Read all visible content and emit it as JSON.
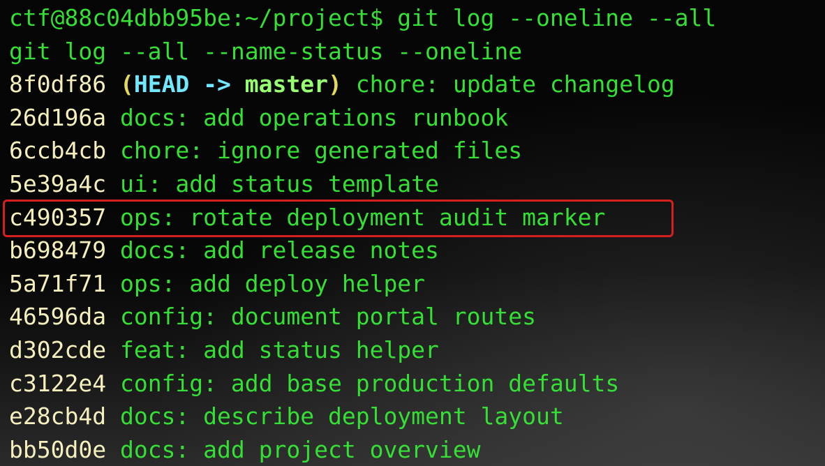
{
  "terminal": {
    "prompt_line": "ctf@88c04dbb95be:~/project$ git log --oneline --all",
    "typed_command": "git log --all --name-status --oneline",
    "head_ref": {
      "hash": "8f0df86",
      "open_paren": "(",
      "head": "HEAD",
      "arrow": " -> ",
      "branch": "master",
      "close_paren": ")",
      "message": "chore: update changelog"
    },
    "commits": [
      {
        "hash": "26d196a",
        "message": "docs: add operations runbook"
      },
      {
        "hash": "6ccb4cb",
        "message": "chore: ignore generated files"
      },
      {
        "hash": "5e39a4c",
        "message": "ui: add status template"
      },
      {
        "hash": "c490357",
        "message": "ops: rotate deployment audit marker"
      },
      {
        "hash": "b698479",
        "message": "docs: add release notes"
      },
      {
        "hash": "5a71f71",
        "message": "ops: add deploy helper"
      },
      {
        "hash": "46596da",
        "message": "config: document portal routes"
      },
      {
        "hash": "d302cde",
        "message": "feat: add status helper"
      },
      {
        "hash": "c3122e4",
        "message": "config: add base production defaults"
      },
      {
        "hash": "e28cb4d",
        "message": "docs: describe deployment layout"
      },
      {
        "hash": "bb50d0e",
        "message": "docs: add project overview"
      }
    ]
  },
  "colors": {
    "background": "#050505",
    "prompt_text": "#35df35",
    "commit_hash": "#f5efbd",
    "commit_message": "#35df35",
    "head_label": "#72e8ff",
    "branch_label": "#98ff73",
    "highlight_border": "#d62020"
  }
}
